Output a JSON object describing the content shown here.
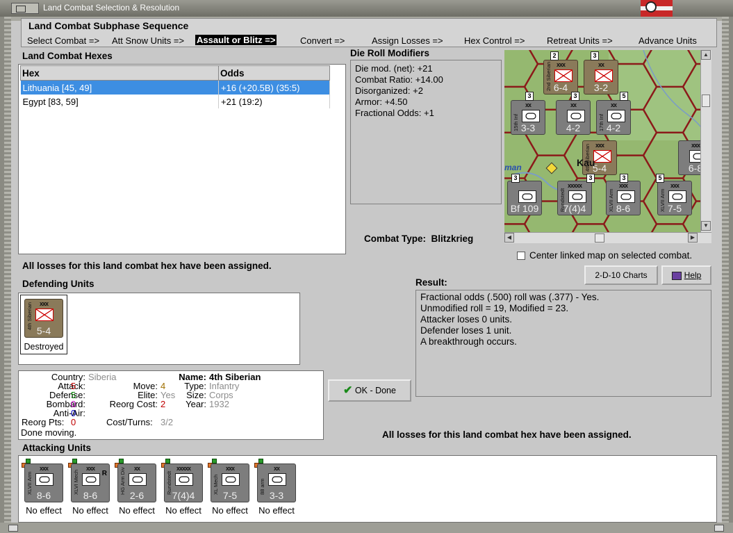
{
  "window": {
    "title": "Land Combat Selection & Resolution"
  },
  "subphase": {
    "title": "Land Combat Subphase Sequence",
    "steps": [
      "Select Combat =>",
      "Att Snow Units =>",
      "Assault or Blitz =>",
      "Convert =>",
      "Assign Losses =>",
      "Hex Control =>",
      "Retreat Units =>",
      "Advance Units"
    ],
    "active_index": 2
  },
  "hexes": {
    "title": "Land Combat Hexes",
    "columns": [
      "Hex",
      "Odds"
    ],
    "rows": [
      {
        "hex": "Lithuania [45, 49]",
        "odds": "+16 (+20.5B) (35:5)"
      },
      {
        "hex": "Egypt [83, 59]",
        "odds": "+21 (19:2)"
      }
    ],
    "selected_index": 0
  },
  "drm": {
    "title": "Die Roll Modifiers",
    "lines": [
      "Die mod. (net): +21",
      "",
      "Combat Ratio: +14.00",
      "Disorganized: +2",
      "Armor: +4.50",
      "Fractional Odds: +1"
    ]
  },
  "map": {
    "town_labels": [
      "Kau",
      "man"
    ],
    "counters": [
      {
        "size": "xxx",
        "val": "6-4",
        "name": "2nd Siberian",
        "color": "tan"
      },
      {
        "size": "xx",
        "val": "3-2",
        "name": "",
        "color": "tan"
      },
      {
        "size": "xx",
        "val": "3-3",
        "name": "15th Inf",
        "color": "gray"
      },
      {
        "size": "xx",
        "val": "4-2",
        "name": "",
        "color": "gray"
      },
      {
        "size": "xx",
        "val": "4-2",
        "name": "17th Inf",
        "color": "gray"
      },
      {
        "size": "xxx",
        "val": "5-4",
        "name": "4th Siberian",
        "color": "tan"
      },
      {
        "size": "xxxxx",
        "val": "7(4)4",
        "name": "Rundstedt",
        "color": "gray"
      },
      {
        "size": "xxx",
        "val": "8-6",
        "name": "XLVII Arm",
        "color": "gray"
      },
      {
        "size": "xxx",
        "val": "7-5",
        "name": "XLVII Arm",
        "color": "gray"
      },
      {
        "size": "xxx",
        "val": "6-8",
        "name": "",
        "color": "gray"
      },
      {
        "size": "",
        "val": "Bf 109",
        "name": "",
        "color": "gray"
      }
    ],
    "stack_counts": [
      "2",
      "3",
      "3",
      "3",
      "5",
      "3",
      "3",
      "3",
      "5"
    ],
    "air_label": "Bf 109"
  },
  "combat_type": {
    "label": "Combat Type:",
    "value": "Blitzkrieg"
  },
  "center_map": {
    "label": "Center linked map on selected combat.",
    "checked": false
  },
  "losses_msg": "All losses for this land combat hex have been assigned.",
  "defending": {
    "title": "Defending Units",
    "units": [
      {
        "size": "xxx",
        "val": "5-4",
        "name": "4th Siberian",
        "status": "Destroyed"
      }
    ]
  },
  "buttons": {
    "charts": "2-D-10 Charts",
    "help": "Help",
    "ok": "OK - Done"
  },
  "result": {
    "title": "Result:",
    "lines": [
      "Fractional odds (.500) roll was (.377)  - Yes.",
      "Unmodified roll = 19, Modified = 23.",
      "Attacker loses 0 units.",
      "Defender loses 1 unit.",
      "A breakthrough occurs."
    ]
  },
  "unit_info": {
    "country_label": "Country:",
    "country": "Siberia",
    "attack_label": "Attack:",
    "attack": "5",
    "defense_label": "Defense:",
    "defense": "5",
    "bombard_label": "Bombard:",
    "bombard": "0",
    "antiair_label": "Anti-Air:",
    "antiair": "0",
    "reorg_pts_label": "Reorg Pts:",
    "reorg_pts": "0",
    "done_moving": "Done moving.",
    "move_label": "Move:",
    "move": "4",
    "elite_label": "Elite:",
    "elite": "Yes",
    "reorg_cost_label": "Reorg Cost:",
    "reorg_cost": "2",
    "cost_turns_label": "Cost/Turns:",
    "cost_turns": "3/2",
    "name_label": "Name:",
    "name": "4th Siberian",
    "type_label": "Type:",
    "type": "Infantry",
    "size_label": "Size:",
    "size": "Corps",
    "year_label": "Year:",
    "year": "1932"
  },
  "attacking": {
    "title": "Attacking Units",
    "units": [
      {
        "size": "xxx",
        "val": "8-6",
        "name": "XLVII Arm",
        "status": "No effect",
        "extra": ""
      },
      {
        "size": "xxx",
        "val": "8-6",
        "name": "XLVI Mech",
        "status": "No effect",
        "extra": "R"
      },
      {
        "size": "xx",
        "val": "2-6",
        "name": "HG Arm Div",
        "status": "No effect",
        "extra": ""
      },
      {
        "size": "xxxxx",
        "val": "7(4)4",
        "name": "Rundstedt",
        "status": "No effect",
        "extra": ""
      },
      {
        "size": "xxx",
        "val": "7-5",
        "name": "XL Mech",
        "status": "No effect",
        "extra": ""
      },
      {
        "size": "xx",
        "val": "3-3",
        "name": "88 arm",
        "status": "No effect",
        "extra": ""
      }
    ]
  },
  "colors": {
    "selected_row": "#3d8ee2",
    "attack": "#c00000",
    "defense": "#008000",
    "bombard": "#c000c0",
    "antiair": "#0000c0",
    "reorg_pts": "#c00000",
    "move": "#a07000",
    "reorg_cost": "#c00000",
    "gray_value": "#8c8c8c",
    "hex_border": "#8b1a1a"
  }
}
